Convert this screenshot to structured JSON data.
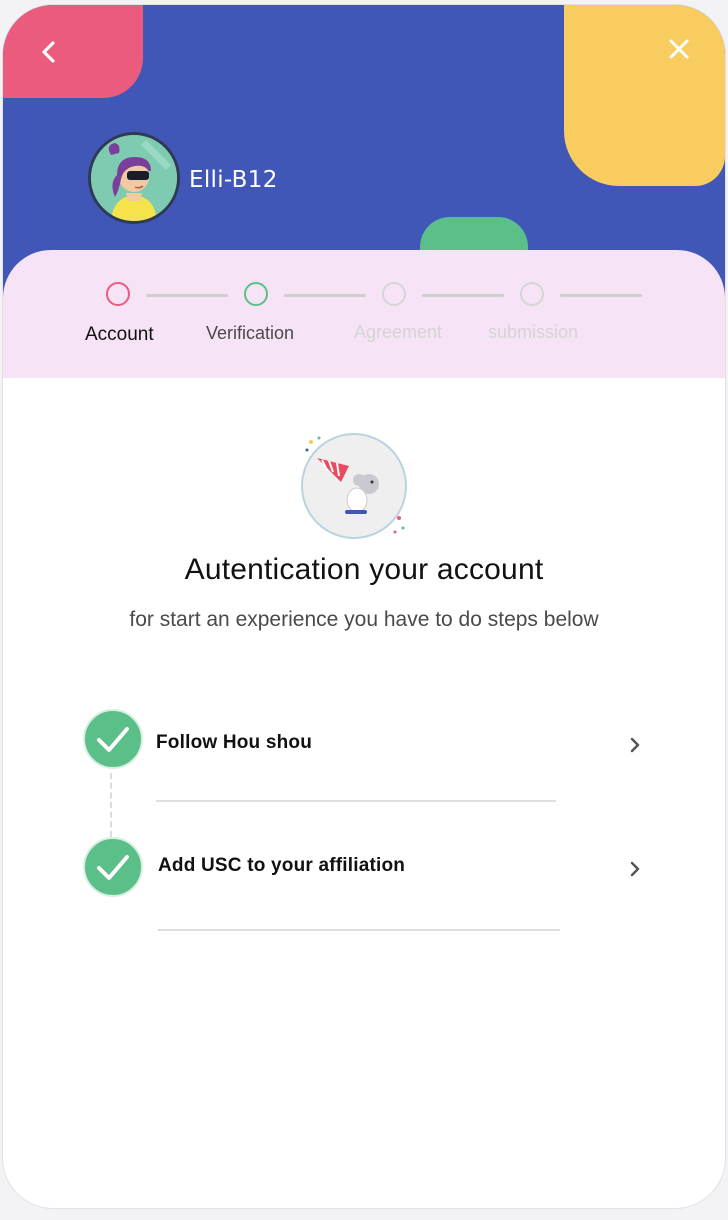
{
  "user": {
    "name": "Elli-B12"
  },
  "stepper": {
    "steps": [
      {
        "label": "Account",
        "state": "active",
        "ring_color": "#ea5b7e"
      },
      {
        "label": "Verification",
        "state": "current",
        "ring_color": "#5bbf89"
      },
      {
        "label": "Agreement",
        "state": "pending",
        "ring_color": "#d6d6d6"
      },
      {
        "label": "submission",
        "state": "pending",
        "ring_color": "#d6d6d6"
      }
    ]
  },
  "main": {
    "title": "Autentication your account",
    "subtitle": "for start an experience you have to do steps below",
    "tasks": [
      {
        "label": "Follow Hou shou",
        "done": true
      },
      {
        "label": "Add USC to your affiliation",
        "done": true
      }
    ]
  },
  "icons": {
    "back": "chevron-left-icon",
    "close": "close-icon",
    "check": "check-icon",
    "chevron": "chevron-right-icon"
  },
  "colors": {
    "header_bg": "#4157b8",
    "pink": "#ea5b7e",
    "yellow": "#f8cc5e",
    "green": "#5bbf89",
    "stepper_bg": "#f7e3f6"
  }
}
